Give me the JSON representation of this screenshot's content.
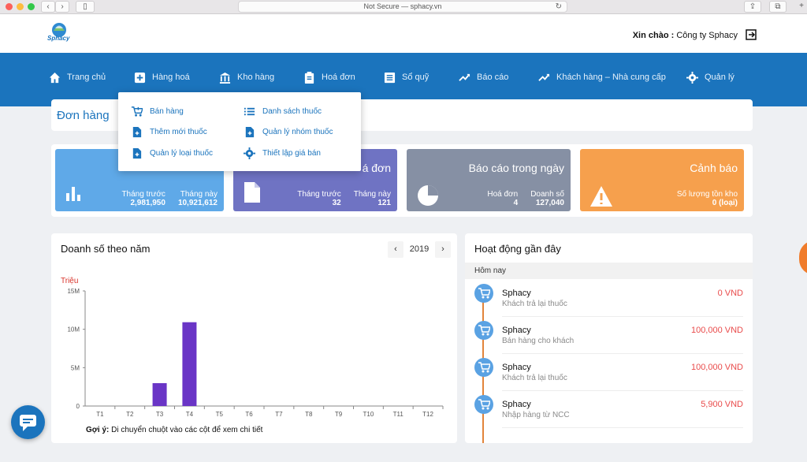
{
  "browser": {
    "url_text": "Not Secure — sphacy.vn"
  },
  "header": {
    "logo_text": "Sphacy",
    "greeting_label": "Xin chào :",
    "company": "Công ty Sphacy"
  },
  "nav": [
    {
      "label": "Trang chủ"
    },
    {
      "label": "Hàng hoá"
    },
    {
      "label": "Kho hàng"
    },
    {
      "label": "Hoá đơn"
    },
    {
      "label": "Sổ quỹ"
    },
    {
      "label": "Báo cáo"
    },
    {
      "label": "Khách hàng – Nhà cung cấp"
    },
    {
      "label": "Quản lý"
    }
  ],
  "dropdown": {
    "left": [
      "Bán hàng",
      "Thêm mới thuốc",
      "Quản lý loại thuốc"
    ],
    "right": [
      "Danh sách thuốc",
      "Quản lý nhóm thuốc",
      "Thiết lập giá bán"
    ]
  },
  "page_title": "Đơn hàng",
  "stats": [
    {
      "title": "",
      "cols": [
        {
          "label": "Tháng trước",
          "value": "2,981,950"
        },
        {
          "label": "Tháng này",
          "value": "10,921,612"
        }
      ],
      "color": "#5fa9e8"
    },
    {
      "title": "á đơn",
      "cols": [
        {
          "label": "Tháng trước",
          "value": "32"
        },
        {
          "label": "Tháng này",
          "value": "121"
        }
      ],
      "color": "#6f73c3"
    },
    {
      "title": "Báo cáo trong ngày",
      "cols": [
        {
          "label": "Hoá đơn",
          "value": "4"
        },
        {
          "label": "Doanh số",
          "value": "127,040"
        }
      ],
      "color": "#8690a4"
    },
    {
      "title": "Cảnh báo",
      "cols": [
        {
          "label": "Số lượng tồn kho",
          "value": "0 (loại)"
        }
      ],
      "color": "#f6a04d"
    }
  ],
  "revenue": {
    "title": "Doanh số theo năm",
    "year": "2019",
    "prev": "‹",
    "next": "›",
    "hint_label": "Gợi ý:",
    "hint_text": "Di chuyển chuột vào các cột để xem chi tiết"
  },
  "chart_data": {
    "type": "bar",
    "title": "",
    "ylabel": "Triệu",
    "categories": [
      "T1",
      "T2",
      "T3",
      "T4",
      "T5",
      "T6",
      "T7",
      "T8",
      "T9",
      "T10",
      "T11",
      "T12"
    ],
    "values": [
      0,
      0,
      2.98,
      10.92,
      0,
      0,
      0,
      0,
      0,
      0,
      0,
      0
    ],
    "ylim": [
      0,
      15
    ],
    "yticks": [
      0,
      5,
      10,
      15
    ],
    "ytick_labels": [
      "0",
      "5M",
      "10M",
      "15M"
    ],
    "bar_color": "#6a35c6"
  },
  "activity": {
    "title": "Hoạt động gần đây",
    "today": "Hôm nay",
    "items": [
      {
        "name": "Sphacy",
        "desc": "Khách trả lại thuốc",
        "amount": "0 VND"
      },
      {
        "name": "Sphacy",
        "desc": "Bán hàng cho khách",
        "amount": "100,000 VND"
      },
      {
        "name": "Sphacy",
        "desc": "Khách trả lại thuốc",
        "amount": "100,000 VND"
      },
      {
        "name": "Sphacy",
        "desc": "Nhập hàng từ NCC",
        "amount": "5,900 VND"
      }
    ]
  }
}
